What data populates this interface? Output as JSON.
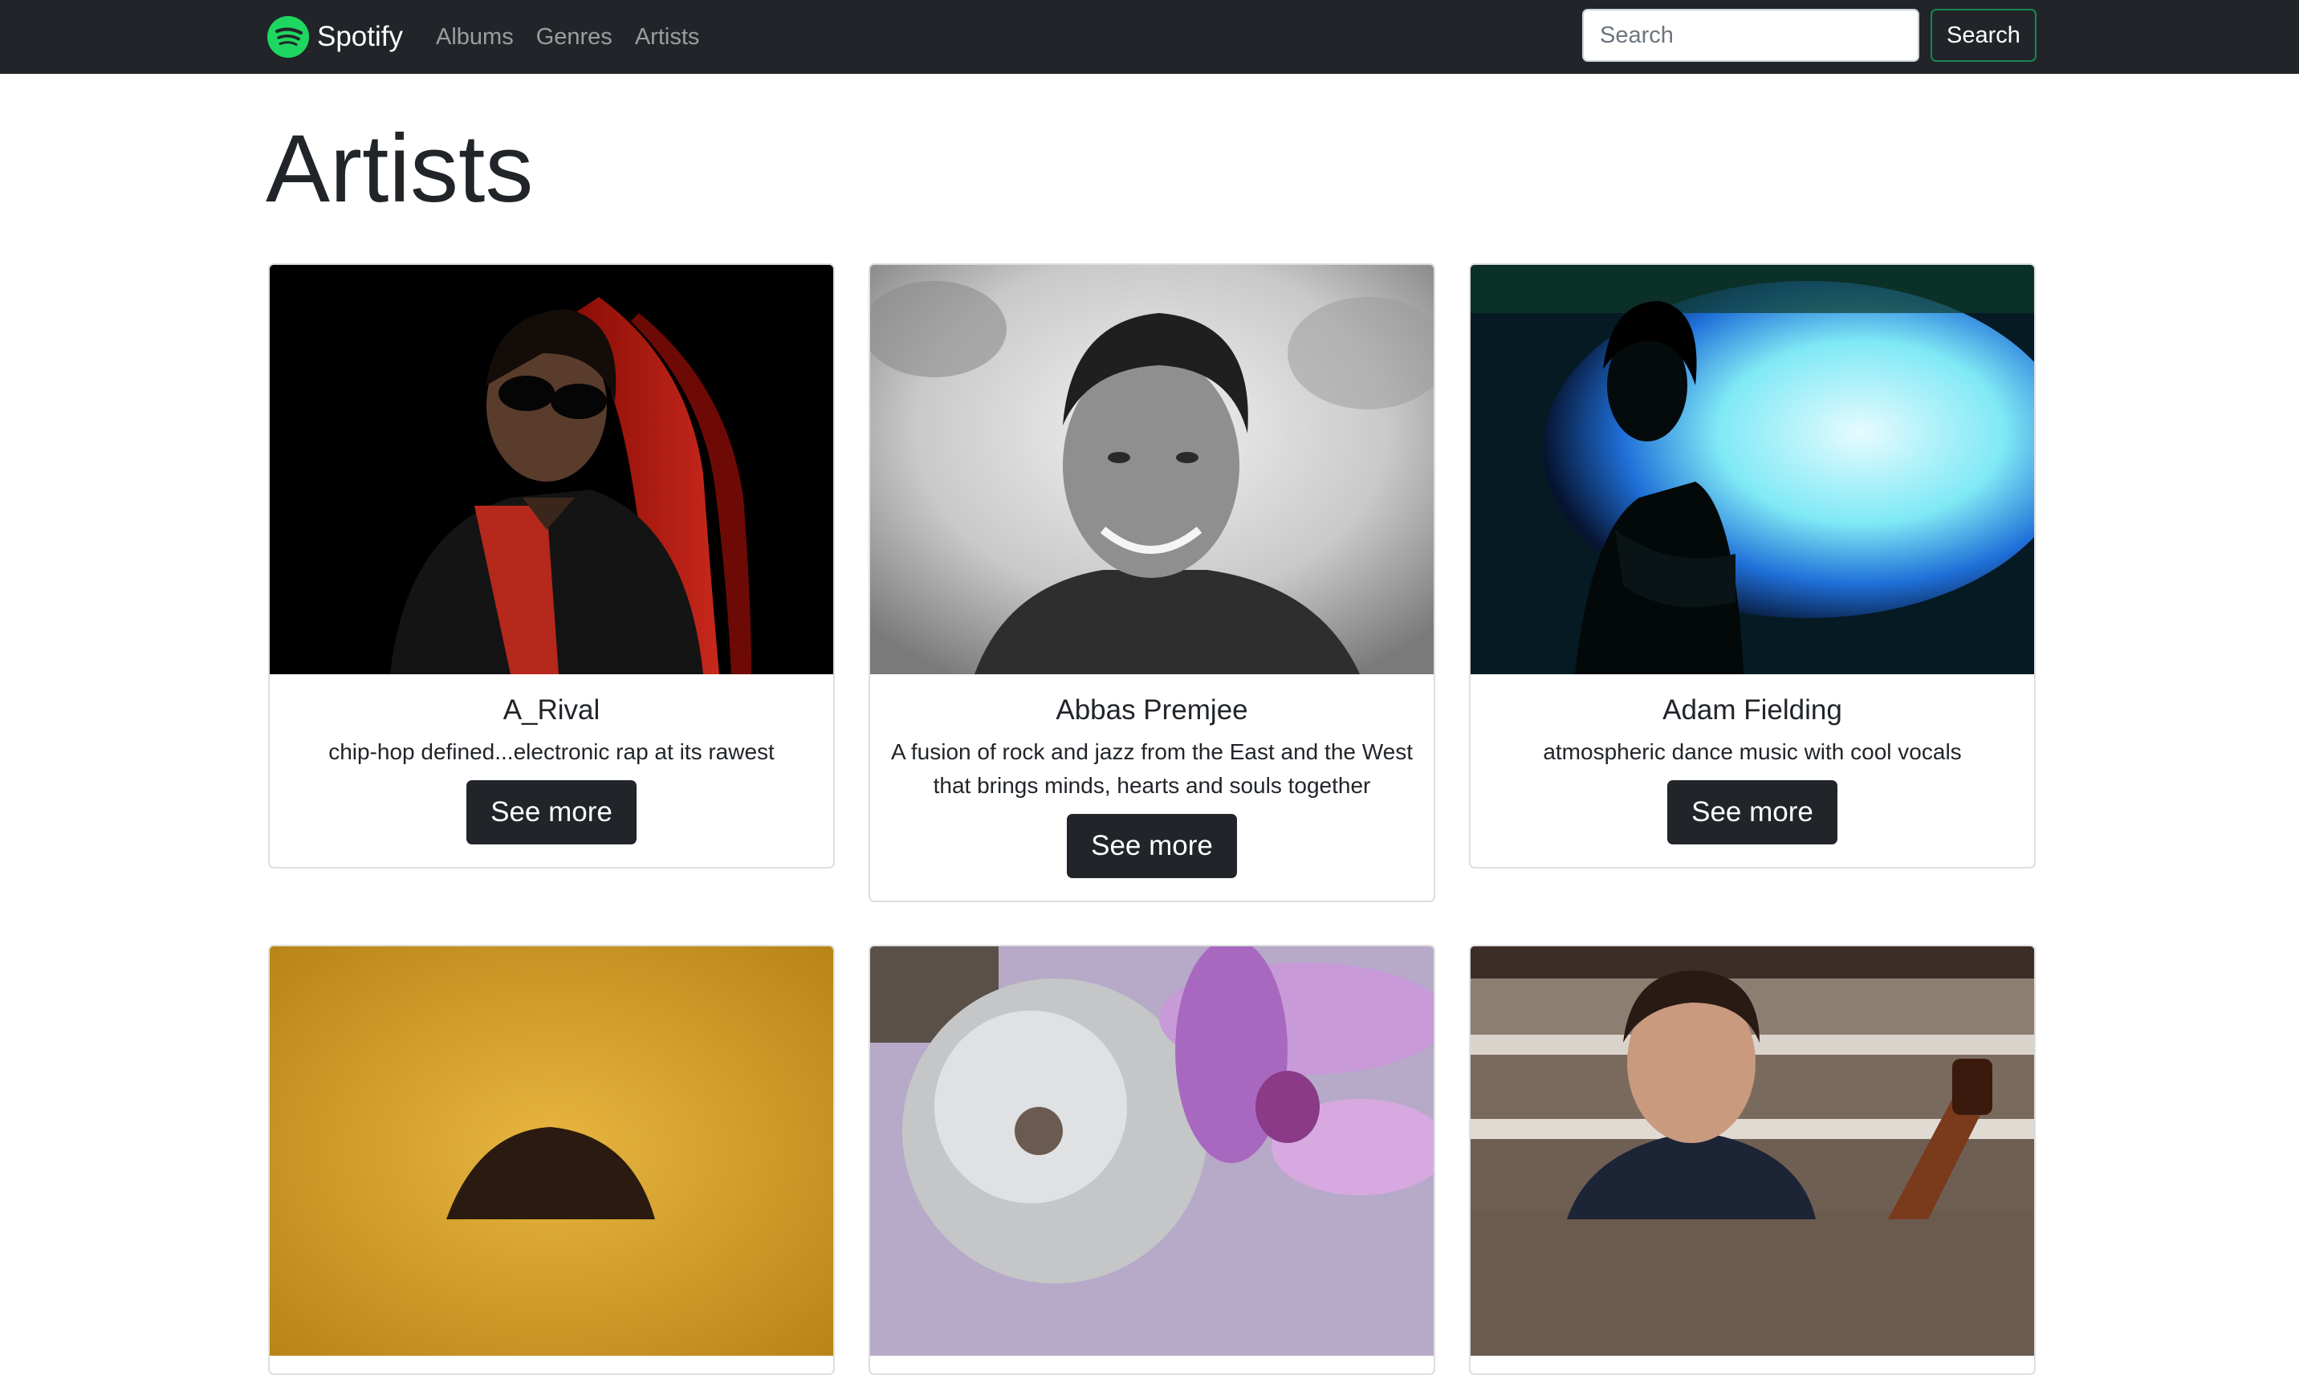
{
  "navbar": {
    "brand": "Spotify",
    "links": [
      "Albums",
      "Genres",
      "Artists"
    ],
    "search_placeholder": "Search",
    "search_button": "Search"
  },
  "page_title": "Artists",
  "artists": [
    {
      "name": "A_Rival",
      "description": "chip-hop defined...electronic rap at its rawest",
      "button": "See more"
    },
    {
      "name": "Abbas Premjee",
      "description": "A fusion of rock and jazz from the East and the West that brings minds, hearts and souls together",
      "button": "See more"
    },
    {
      "name": "Adam Fielding",
      "description": "atmospheric dance music with cool vocals",
      "button": "See more"
    },
    {
      "name": "",
      "description": "",
      "button": ""
    },
    {
      "name": "",
      "description": "",
      "button": ""
    },
    {
      "name": "",
      "description": "",
      "button": ""
    }
  ],
  "colors": {
    "navbar_bg": "#212529",
    "spotify_green": "#1ed760",
    "search_button_border": "#198754",
    "button_dark": "#212529"
  }
}
